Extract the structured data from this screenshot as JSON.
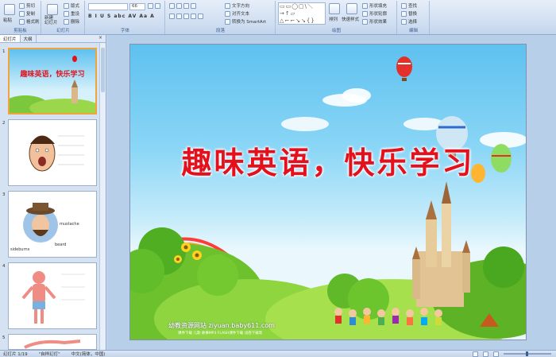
{
  "ribbon": {
    "groups": {
      "clipboard": "剪贴板",
      "slides": "幻灯片",
      "font": "字体",
      "paragraph": "段落",
      "drawing": "绘图",
      "editing": "编辑"
    },
    "buttons": {
      "paste": "粘贴",
      "cut": "剪切",
      "copy": "复制",
      "format_painter": "格式刷",
      "new_slide": "新建\n幻灯片",
      "layout": "版式",
      "reset": "重设",
      "delete": "删除",
      "text_direction": "文字方向",
      "align_text": "对齐文本",
      "smartart": "转换为 SmartArt",
      "arrange": "排列",
      "quick_styles": "快速样式",
      "shape_fill": "形状填充",
      "shape_outline": "形状轮廓",
      "shape_effects": "形状效果",
      "find": "查找",
      "replace": "替换",
      "select": "选择"
    },
    "font_size": "66",
    "font_name": ""
  },
  "left_panel": {
    "tabs": [
      "幻灯片",
      "大纲"
    ],
    "close": "×",
    "slide_numbers": [
      "1",
      "2",
      "3",
      "4",
      "5"
    ],
    "thumb3_labels": [
      "mustache",
      "sideburns",
      "beard"
    ]
  },
  "slide": {
    "title": "趣味英语，快乐学习",
    "watermark": "幼教资源网站  ziyuan.baby611.com",
    "watermark_sub": "课件下载  儿歌  故事MP3  FLASH课件下载  试卷下载等"
  },
  "status": {
    "slide_count": "幻灯片 1/19",
    "theme": "\"自样幻灯\"",
    "language": "中文(简体，中国)"
  },
  "colors": {
    "title_red": "#e4111c",
    "ribbon_bg": "#cfdef1",
    "selection": "#f0a43a"
  }
}
